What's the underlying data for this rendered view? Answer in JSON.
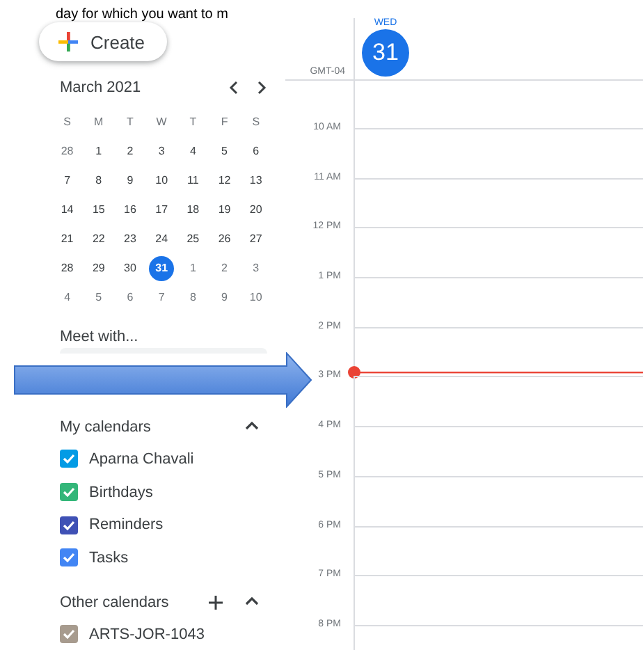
{
  "caption": "day for which you want to m",
  "create_button": {
    "label": "Create"
  },
  "mini_calendar": {
    "title": "March 2021",
    "weekdays": [
      "S",
      "M",
      "T",
      "W",
      "T",
      "F",
      "S"
    ],
    "days": [
      {
        "label": "28",
        "outside": true,
        "selected": false
      },
      {
        "label": "1",
        "outside": false,
        "selected": false
      },
      {
        "label": "2",
        "outside": false,
        "selected": false
      },
      {
        "label": "3",
        "outside": false,
        "selected": false
      },
      {
        "label": "4",
        "outside": false,
        "selected": false
      },
      {
        "label": "5",
        "outside": false,
        "selected": false
      },
      {
        "label": "6",
        "outside": false,
        "selected": false
      },
      {
        "label": "7",
        "outside": false,
        "selected": false
      },
      {
        "label": "8",
        "outside": false,
        "selected": false
      },
      {
        "label": "9",
        "outside": false,
        "selected": false
      },
      {
        "label": "10",
        "outside": false,
        "selected": false
      },
      {
        "label": "11",
        "outside": false,
        "selected": false
      },
      {
        "label": "12",
        "outside": false,
        "selected": false
      },
      {
        "label": "13",
        "outside": false,
        "selected": false
      },
      {
        "label": "14",
        "outside": false,
        "selected": false
      },
      {
        "label": "15",
        "outside": false,
        "selected": false
      },
      {
        "label": "16",
        "outside": false,
        "selected": false
      },
      {
        "label": "17",
        "outside": false,
        "selected": false
      },
      {
        "label": "18",
        "outside": false,
        "selected": false
      },
      {
        "label": "19",
        "outside": false,
        "selected": false
      },
      {
        "label": "20",
        "outside": false,
        "selected": false
      },
      {
        "label": "21",
        "outside": false,
        "selected": false
      },
      {
        "label": "22",
        "outside": false,
        "selected": false
      },
      {
        "label": "23",
        "outside": false,
        "selected": false
      },
      {
        "label": "24",
        "outside": false,
        "selected": false
      },
      {
        "label": "25",
        "outside": false,
        "selected": false
      },
      {
        "label": "26",
        "outside": false,
        "selected": false
      },
      {
        "label": "27",
        "outside": false,
        "selected": false
      },
      {
        "label": "28",
        "outside": false,
        "selected": false
      },
      {
        "label": "29",
        "outside": false,
        "selected": false
      },
      {
        "label": "30",
        "outside": false,
        "selected": false
      },
      {
        "label": "31",
        "outside": false,
        "selected": true
      },
      {
        "label": "1",
        "outside": true,
        "selected": false
      },
      {
        "label": "2",
        "outside": true,
        "selected": false
      },
      {
        "label": "3",
        "outside": true,
        "selected": false
      },
      {
        "label": "4",
        "outside": true,
        "selected": false
      },
      {
        "label": "5",
        "outside": true,
        "selected": false
      },
      {
        "label": "6",
        "outside": true,
        "selected": false
      },
      {
        "label": "7",
        "outside": true,
        "selected": false
      },
      {
        "label": "8",
        "outside": true,
        "selected": false
      },
      {
        "label": "9",
        "outside": true,
        "selected": false
      },
      {
        "label": "10",
        "outside": true,
        "selected": false
      }
    ]
  },
  "meet_with": {
    "title": "Meet with..."
  },
  "my_calendars": {
    "title": "My calendars",
    "expanded": true,
    "items": [
      {
        "label": "Aparna Chavali",
        "checked": true,
        "color": "#039be5"
      },
      {
        "label": "Birthdays",
        "checked": true,
        "color": "#33b679"
      },
      {
        "label": "Reminders",
        "checked": true,
        "color": "#3f51b5"
      },
      {
        "label": "Tasks",
        "checked": true,
        "color": "#4285f4"
      }
    ]
  },
  "other_calendars": {
    "title": "Other calendars",
    "expanded": true,
    "items": [
      {
        "label": "ARTS-JOR-1043",
        "checked": true,
        "color": "#a79b8e"
      }
    ]
  },
  "day_view": {
    "weekday": "WED",
    "date": "31",
    "today": true,
    "timezone": "GMT-04",
    "hours": [
      {
        "label": "10 AM",
        "now": false
      },
      {
        "label": "11 AM",
        "now": false
      },
      {
        "label": "12 PM",
        "now": false
      },
      {
        "label": "1 PM",
        "now": false
      },
      {
        "label": "2 PM",
        "now": true
      },
      {
        "label": "3 PM",
        "now": false
      },
      {
        "label": "4 PM",
        "now": false
      },
      {
        "label": "5 PM",
        "now": false
      },
      {
        "label": "6 PM",
        "now": false
      },
      {
        "label": "7 PM",
        "now": false
      },
      {
        "label": "8 PM",
        "now": false
      }
    ]
  }
}
